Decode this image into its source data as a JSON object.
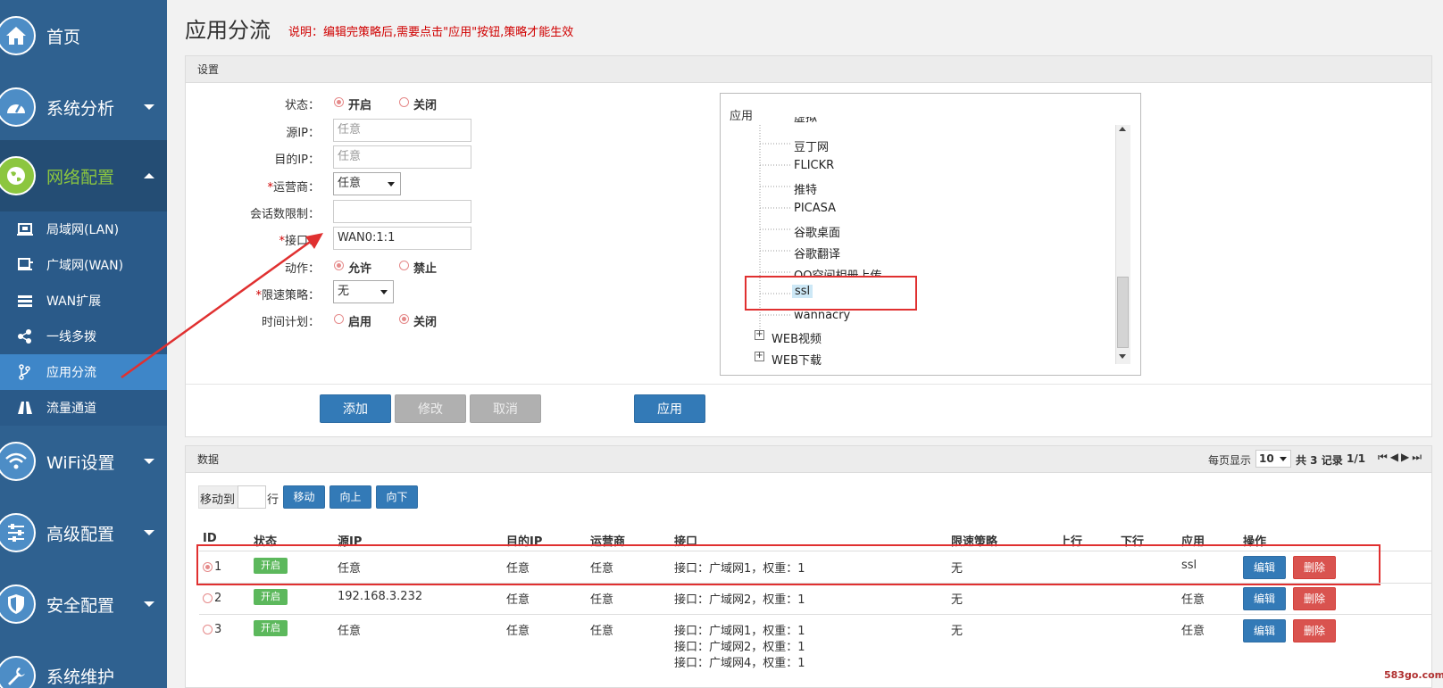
{
  "sidebar": {
    "main_items": [
      {
        "label": "首页",
        "icon": "home-icon"
      },
      {
        "label": "系统分析",
        "icon": "dashboard-icon"
      },
      {
        "label": "网络配置",
        "icon": "globe-icon"
      },
      {
        "label": "WiFi设置",
        "icon": "wifi-icon"
      },
      {
        "label": "高级配置",
        "icon": "sliders-icon"
      },
      {
        "label": "安全配置",
        "icon": "shield-icon"
      },
      {
        "label": "系统维护",
        "icon": "wrench-icon"
      }
    ],
    "sub_items": [
      {
        "label": "局域网(LAN)",
        "icon": "lan-icon"
      },
      {
        "label": "广域网(WAN)",
        "icon": "wan-icon"
      },
      {
        "label": "WAN扩展",
        "icon": "list-icon"
      },
      {
        "label": "一线多拨",
        "icon": "share-icon"
      },
      {
        "label": "应用分流",
        "icon": "branch-icon"
      },
      {
        "label": "流量通道",
        "icon": "road-icon"
      }
    ]
  },
  "header": {
    "title": "应用分流",
    "note": "说明：编辑完策略后,需要点击\"应用\"按钮,策略才能生效"
  },
  "settings": {
    "panel_title": "设置",
    "status_label": "状态：",
    "status_on": "开启",
    "status_off": "关闭",
    "src_ip_label": "源IP：",
    "src_ip_placeholder": "任意",
    "dst_ip_label": "目的IP：",
    "dst_ip_placeholder": "任意",
    "isp_label_req": "*",
    "isp_label": "运营商：",
    "isp_value": "任意",
    "session_label": "会话数限制：",
    "session_value": "",
    "iface_label_req": "*",
    "iface_label": "接口：",
    "iface_value": "WAN0:1:1",
    "action_label": "动作：",
    "action_allow": "允许",
    "action_deny": "禁止",
    "limit_label_req": "*",
    "limit_label": "限速策略：",
    "limit_value": "无",
    "schedule_label": "时间计划：",
    "schedule_on": "启用",
    "schedule_off": "关闭",
    "add_button": "添加",
    "modify_button": "修改",
    "cancel_button": "取消",
    "apply_button": "应用"
  },
  "app_tree": {
    "title": "应用",
    "items": [
      "虚拟",
      "豆丁网",
      "FLICKR",
      "推特",
      "PICASA",
      "谷歌桌面",
      "谷歌翻译",
      "QQ空间相册上传",
      "ssl",
      "wannacry"
    ],
    "groups": [
      "WEB视频",
      "WEB下载"
    ],
    "selected": "ssl"
  },
  "data_panel": {
    "title": "数据",
    "per_page_label": "每页显示",
    "per_page_value": "10",
    "total_text": "共 3 记录",
    "page_text": "1/1",
    "move_to_label": "移动到",
    "row_label": "行",
    "move_button": "移动",
    "up_button": "向上",
    "down_button": "向下",
    "columns": [
      "ID",
      "状态",
      "源IP",
      "目的IP",
      "运营商",
      "接口",
      "限速策略",
      "上行",
      "下行",
      "应用",
      "操作"
    ],
    "rows": [
      {
        "id": "1",
        "status": "开启",
        "src": "任意",
        "dst": "任意",
        "isp": "任意",
        "iface": [
          "接口：广域网1，权重：1"
        ],
        "limit": "无",
        "up": "",
        "down": "",
        "app": "ssl",
        "edit": "编辑",
        "delete": "删除"
      },
      {
        "id": "2",
        "status": "开启",
        "src": "192.168.3.232",
        "dst": "任意",
        "isp": "任意",
        "iface": [
          "接口：广域网2，权重：1"
        ],
        "limit": "无",
        "up": "",
        "down": "",
        "app": "任意",
        "edit": "编辑",
        "delete": "删除"
      },
      {
        "id": "3",
        "status": "开启",
        "src": "任意",
        "dst": "任意",
        "isp": "任意",
        "iface": [
          "接口：广域网1，权重：1",
          "接口：广域网2，权重：1",
          "接口：广域网4，权重：1"
        ],
        "limit": "无",
        "up": "",
        "down": "",
        "app": "任意",
        "edit": "编辑",
        "delete": "删除"
      }
    ]
  },
  "watermark": "583go.com",
  "colors": {
    "sidebar": "#2f6190",
    "active_green": "#8cc63f",
    "primary": "#337ab7",
    "danger": "#d9534f",
    "highlight": "#e03030"
  }
}
